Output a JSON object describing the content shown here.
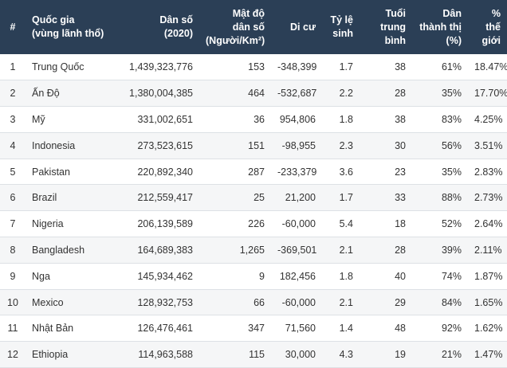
{
  "headers": {
    "rank": [
      "#"
    ],
    "country": [
      "Quốc gia",
      "(vùng lãnh thổ)"
    ],
    "population": [
      "Dân số",
      "(2020)"
    ],
    "density": [
      "Mật độ",
      "dân số",
      "(Người/Km²)"
    ],
    "migrants": [
      "Di cư"
    ],
    "fertility": [
      "Tỷ lệ",
      "sinh"
    ],
    "median_age": [
      "Tuổi",
      "trung",
      "bình"
    ],
    "urban": [
      "Dân",
      "thành thị",
      "(%)"
    ],
    "world_share": [
      "% thế",
      "giới"
    ]
  },
  "rows": [
    {
      "rank": "1",
      "country": "Trung Quốc",
      "population": "1,439,323,776",
      "density": "153",
      "migrants": "-348,399",
      "fertility": "1.7",
      "median_age": "38",
      "urban": "61%",
      "world_share": "18.47%"
    },
    {
      "rank": "2",
      "country": "Ấn Độ",
      "population": "1,380,004,385",
      "density": "464",
      "migrants": "-532,687",
      "fertility": "2.2",
      "median_age": "28",
      "urban": "35%",
      "world_share": "17.70%"
    },
    {
      "rank": "3",
      "country": "Mỹ",
      "population": "331,002,651",
      "density": "36",
      "migrants": "954,806",
      "fertility": "1.8",
      "median_age": "38",
      "urban": "83%",
      "world_share": "4.25%"
    },
    {
      "rank": "4",
      "country": "Indonesia",
      "population": "273,523,615",
      "density": "151",
      "migrants": "-98,955",
      "fertility": "2.3",
      "median_age": "30",
      "urban": "56%",
      "world_share": "3.51%"
    },
    {
      "rank": "5",
      "country": "Pakistan",
      "population": "220,892,340",
      "density": "287",
      "migrants": "-233,379",
      "fertility": "3.6",
      "median_age": "23",
      "urban": "35%",
      "world_share": "2.83%"
    },
    {
      "rank": "6",
      "country": "Brazil",
      "population": "212,559,417",
      "density": "25",
      "migrants": "21,200",
      "fertility": "1.7",
      "median_age": "33",
      "urban": "88%",
      "world_share": "2.73%"
    },
    {
      "rank": "7",
      "country": "Nigeria",
      "population": "206,139,589",
      "density": "226",
      "migrants": "-60,000",
      "fertility": "5.4",
      "median_age": "18",
      "urban": "52%",
      "world_share": "2.64%"
    },
    {
      "rank": "8",
      "country": "Bangladesh",
      "population": "164,689,383",
      "density": "1,265",
      "migrants": "-369,501",
      "fertility": "2.1",
      "median_age": "28",
      "urban": "39%",
      "world_share": "2.11%"
    },
    {
      "rank": "9",
      "country": "Nga",
      "population": "145,934,462",
      "density": "9",
      "migrants": "182,456",
      "fertility": "1.8",
      "median_age": "40",
      "urban": "74%",
      "world_share": "1.87%"
    },
    {
      "rank": "10",
      "country": "Mexico",
      "population": "128,932,753",
      "density": "66",
      "migrants": "-60,000",
      "fertility": "2.1",
      "median_age": "29",
      "urban": "84%",
      "world_share": "1.65%"
    },
    {
      "rank": "11",
      "country": "Nhật Bản",
      "population": "126,476,461",
      "density": "347",
      "migrants": "71,560",
      "fertility": "1.4",
      "median_age": "48",
      "urban": "92%",
      "world_share": "1.62%"
    },
    {
      "rank": "12",
      "country": "Ethiopia",
      "population": "114,963,588",
      "density": "115",
      "migrants": "30,000",
      "fertility": "4.3",
      "median_age": "19",
      "urban": "21%",
      "world_share": "1.47%"
    }
  ]
}
